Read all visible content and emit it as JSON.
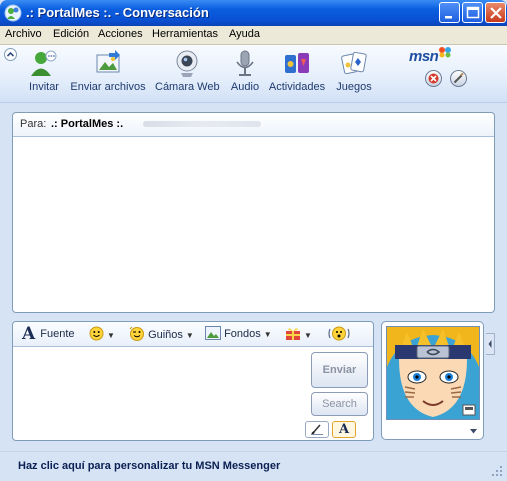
{
  "window": {
    "title": ".: PortalMes :. - Conversación",
    "controls": [
      "minimize",
      "maximize",
      "close"
    ]
  },
  "menu": [
    "Archivo",
    "Edición",
    "Acciones",
    "Herramientas",
    "Ayuda"
  ],
  "toolbar": [
    {
      "label": "Invitar",
      "icon": "invite-icon"
    },
    {
      "label": "Enviar archivos",
      "icon": "send-files-icon"
    },
    {
      "label": "Cámara Web",
      "icon": "webcam-icon"
    },
    {
      "label": "Audio",
      "icon": "microphone-icon"
    },
    {
      "label": "Actividades",
      "icon": "activities-icon"
    },
    {
      "label": "Juegos",
      "icon": "games-icon"
    }
  ],
  "brand": {
    "logo_text": "msn"
  },
  "conversation": {
    "to_label": "Para:",
    "contact_name": ".: PortalMes :."
  },
  "format_bar": {
    "font": "Fuente",
    "winks": "Guiños",
    "backgrounds": "Fondos"
  },
  "compose": {
    "send_label": "Enviar",
    "search_label": "Search",
    "font_glyph": "A"
  },
  "status": {
    "text": "Haz clic aquí para personalizar tu MSN Messenger"
  },
  "colors": {
    "title_blue": "#0b5fe0",
    "panel_border": "#7f9db9",
    "window_bg": "#d6e3f5"
  }
}
